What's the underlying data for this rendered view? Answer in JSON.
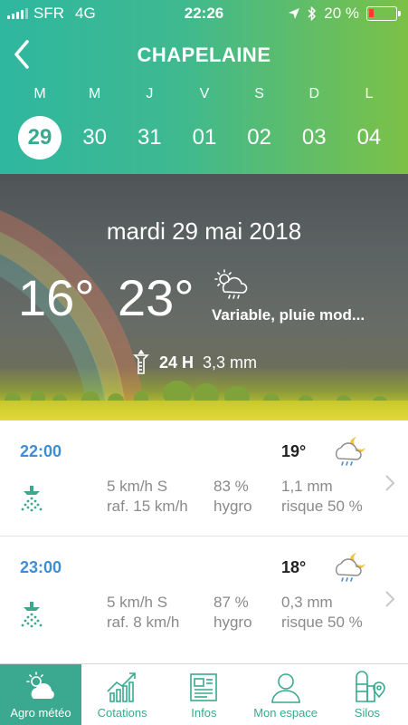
{
  "status_bar": {
    "carrier": "SFR",
    "network": "4G",
    "time": "22:26",
    "battery": "20 %",
    "battery_level": 0.2
  },
  "header": {
    "title": "CHAPELAINE"
  },
  "days": [
    {
      "letter": "M",
      "num": "29",
      "active": true
    },
    {
      "letter": "M",
      "num": "30"
    },
    {
      "letter": "J",
      "num": "31"
    },
    {
      "letter": "V",
      "num": "01"
    },
    {
      "letter": "S",
      "num": "02"
    },
    {
      "letter": "D",
      "num": "03"
    },
    {
      "letter": "L",
      "num": "04"
    }
  ],
  "forecast": {
    "date": "mardi 29 mai 2018",
    "temp_min": "16°",
    "temp_max": "23°",
    "condition": "Variable, pluie mod...",
    "condition_icon": "sun-cloud-rain-icon",
    "rain_label": "24 H",
    "rain_value": "3,3 mm"
  },
  "hours": [
    {
      "time": "22:00",
      "temp": "19°",
      "wind": "5 km/h S",
      "gust": "raf. 15 km/h",
      "humidity": "83 %",
      "humidity_label": "hygro",
      "rain": "1,1 mm",
      "risk": "risque 50 %",
      "icon": "moon-cloud-rain-icon"
    },
    {
      "time": "23:00",
      "temp": "18°",
      "wind": "5 km/h S",
      "gust": "raf. 8 km/h",
      "humidity": "87 %",
      "humidity_label": "hygro",
      "rain": "0,3 mm",
      "risk": "risque 50 %",
      "icon": "moon-cloud-rain-icon"
    }
  ],
  "tabs": [
    {
      "label": "Agro météo",
      "icon": "sun-cloud-icon",
      "active": true
    },
    {
      "label": "Cotations",
      "icon": "chart-up-icon"
    },
    {
      "label": "Infos",
      "icon": "newspaper-icon"
    },
    {
      "label": "Mon espace",
      "icon": "user-icon"
    },
    {
      "label": "Silos",
      "icon": "silo-location-icon"
    }
  ],
  "colors": {
    "accent": "#3aa98f",
    "header_start": "#2fb7a0",
    "header_end": "#7cc146",
    "time_blue": "#3e8ed6",
    "battery_low": "#ff3b30"
  }
}
